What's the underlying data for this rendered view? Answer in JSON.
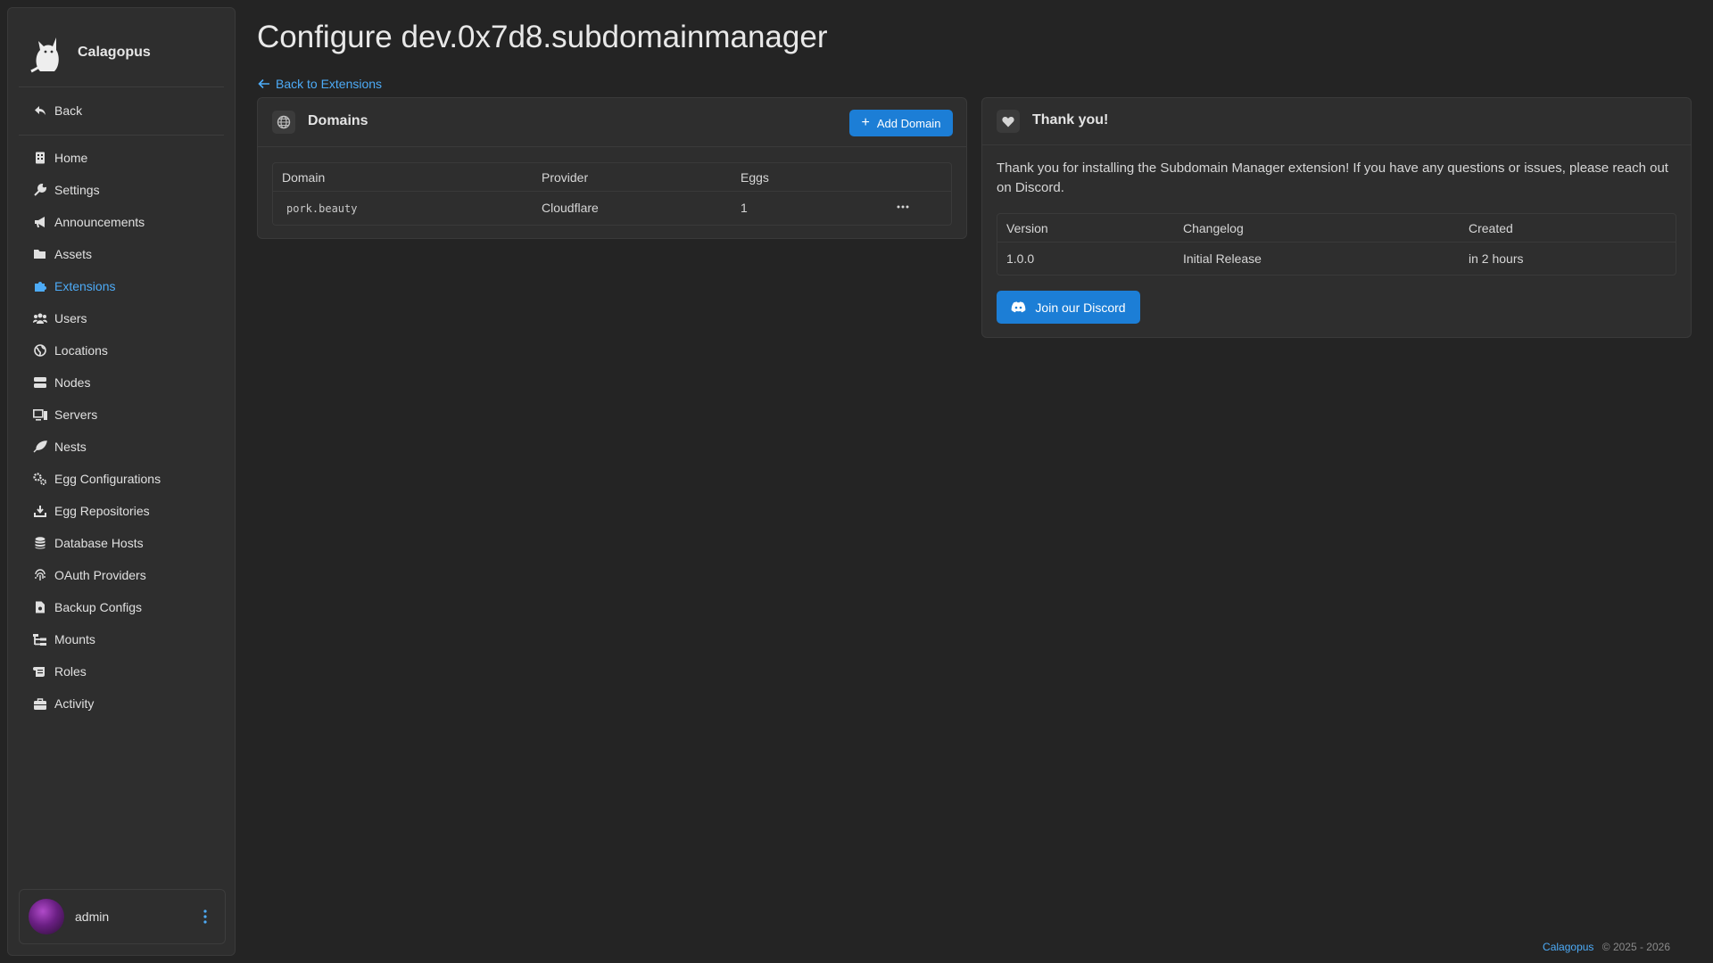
{
  "brand": {
    "name": "Calagopus"
  },
  "sidebar": {
    "back_label": "Back",
    "items": [
      {
        "label": "Home",
        "icon": "building-icon"
      },
      {
        "label": "Settings",
        "icon": "wrench-icon"
      },
      {
        "label": "Announcements",
        "icon": "megaphone-icon"
      },
      {
        "label": "Assets",
        "icon": "folder-icon"
      },
      {
        "label": "Extensions",
        "icon": "puzzle-icon",
        "active": true
      },
      {
        "label": "Users",
        "icon": "users-icon"
      },
      {
        "label": "Locations",
        "icon": "globe-icon"
      },
      {
        "label": "Nodes",
        "icon": "server-icon"
      },
      {
        "label": "Servers",
        "icon": "monitor-icon"
      },
      {
        "label": "Nests",
        "icon": "feather-icon"
      },
      {
        "label": "Egg Configurations",
        "icon": "cogs-icon"
      },
      {
        "label": "Egg Repositories",
        "icon": "download-icon"
      },
      {
        "label": "Database Hosts",
        "icon": "database-icon"
      },
      {
        "label": "OAuth Providers",
        "icon": "fingerprint-icon"
      },
      {
        "label": "Backup Configs",
        "icon": "file-icon"
      },
      {
        "label": "Mounts",
        "icon": "tree-icon"
      },
      {
        "label": "Roles",
        "icon": "scroll-icon"
      },
      {
        "label": "Activity",
        "icon": "briefcase-icon"
      }
    ],
    "user": {
      "name": "admin"
    }
  },
  "main": {
    "title": "Configure dev.0x7d8.subdomainmanager",
    "back_link": "Back to Extensions",
    "domains": {
      "title": "Domains",
      "add_button": "Add Domain",
      "columns": [
        "Domain",
        "Provider",
        "Eggs"
      ],
      "rows": [
        {
          "domain": "pork.beauty",
          "provider": "Cloudflare",
          "eggs": "1"
        }
      ]
    },
    "thanks": {
      "title": "Thank you!",
      "text": "Thank you for installing the Subdomain Manager extension! If you have any questions or issues, please reach out on Discord.",
      "columns": [
        "Version",
        "Changelog",
        "Created"
      ],
      "rows": [
        {
          "version": "1.0.0",
          "changelog": "Initial Release",
          "created": "in 2 hours"
        }
      ],
      "discord_button": "Join our Discord"
    }
  },
  "footer": {
    "brand": "Calagopus",
    "copyright": "© 2025 - 2026"
  },
  "colors": {
    "accent": "#4dabf7",
    "primary_button": "#1c7ed6",
    "background": "#242424",
    "card": "#2e2e2e"
  }
}
